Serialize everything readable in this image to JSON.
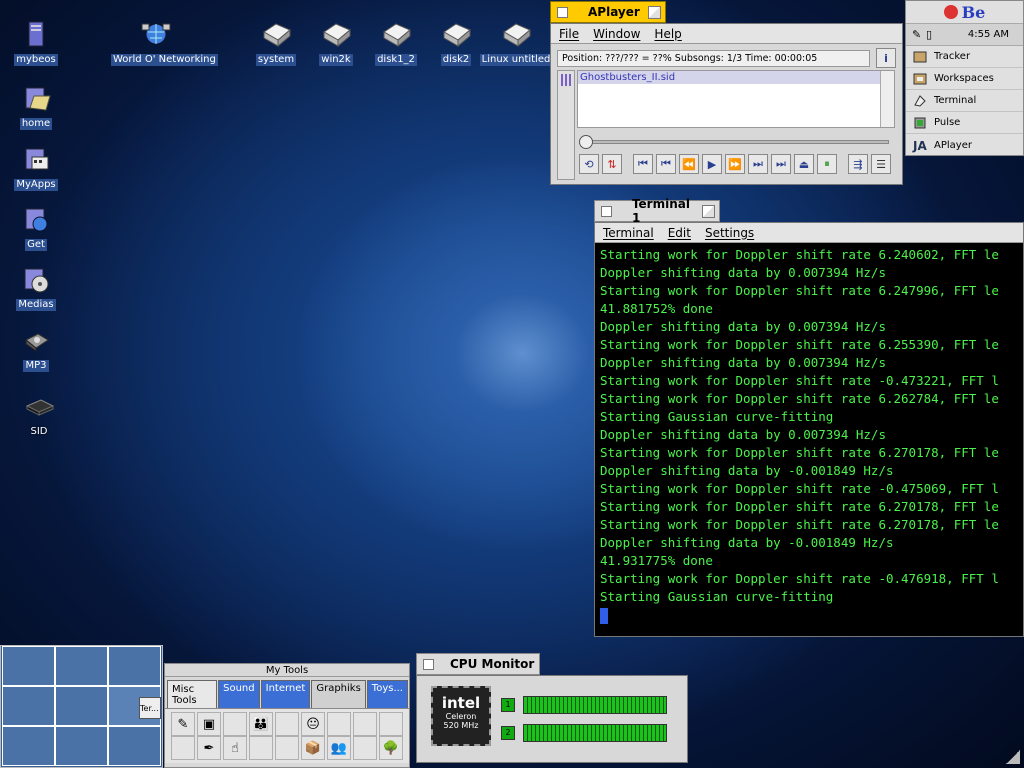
{
  "desktop_icons": [
    {
      "label": "mybeos",
      "icon": "computer-tower-icon",
      "selected": true
    },
    {
      "label": "World O' Networking",
      "icon": "network-globe-icon",
      "selected": true
    },
    {
      "label": "system",
      "icon": "disk-icon",
      "selected": true
    },
    {
      "label": "win2k",
      "icon": "disk-icon",
      "selected": true
    },
    {
      "label": "disk1_2",
      "icon": "disk-icon",
      "selected": true
    },
    {
      "label": "disk2",
      "icon": "disk-icon",
      "selected": true
    },
    {
      "label": "Linux untitled",
      "icon": "disk-icon",
      "selected": true
    },
    {
      "label": "home",
      "icon": "home-folder-icon",
      "selected": true
    },
    {
      "label": "MyApps",
      "icon": "apps-folder-icon",
      "selected": true
    },
    {
      "label": "Get",
      "icon": "get-folder-icon",
      "selected": true
    },
    {
      "label": "Medias",
      "icon": "media-folder-icon",
      "selected": true
    },
    {
      "label": "MP3",
      "icon": "mp3-drive-icon",
      "selected": true
    },
    {
      "label": "SID",
      "icon": "sid-chip-icon",
      "selected": false
    }
  ],
  "aplayer": {
    "title": "APlayer",
    "menus": [
      "File",
      "Window",
      "Help"
    ],
    "status": "Position: ???/??? = ??% Subsongs: 1/3 Time: 00:00:05",
    "playlist": [
      "Ghostbusters_II.sid"
    ]
  },
  "deskbar": {
    "logo": "Be",
    "time": "4:55 AM",
    "items": [
      {
        "label": "Tracker",
        "icon": "tracker-icon"
      },
      {
        "label": "Workspaces",
        "icon": "workspaces-icon"
      },
      {
        "label": "Terminal",
        "icon": "terminal-icon"
      },
      {
        "label": "Pulse",
        "icon": "pulse-icon"
      },
      {
        "label": "APlayer",
        "icon": "aplayer-icon"
      }
    ]
  },
  "terminal": {
    "title": "Terminal 1",
    "menus": [
      "Terminal",
      "Edit",
      "Settings"
    ],
    "lines": [
      "Starting work for Doppler shift rate 6.240602, FFT le",
      "Doppler shifting data by 0.007394 Hz/s",
      "Starting work for Doppler shift rate 6.247996, FFT le",
      "41.881752% done",
      "Doppler shifting data by 0.007394 Hz/s",
      "Starting work for Doppler shift rate 6.255390, FFT le",
      "Doppler shifting data by 0.007394 Hz/s",
      "Starting work for Doppler shift rate -0.473221, FFT l",
      "Starting work for Doppler shift rate 6.262784, FFT le",
      "Starting Gaussian curve-fitting",
      "Doppler shifting data by 0.007394 Hz/s",
      "Starting work for Doppler shift rate 6.270178, FFT le",
      "Doppler shifting data by -0.001849 Hz/s",
      "Starting work for Doppler shift rate -0.475069, FFT l",
      "Starting work for Doppler shift rate 6.270178, FFT le",
      "Starting work for Doppler shift rate 6.270178, FFT le",
      "Doppler shifting data by -0.001849 Hz/s",
      "41.931775% done",
      "Starting work for Doppler shift rate -0.476918, FFT l",
      "Starting Gaussian curve-fitting"
    ],
    "colors": {
      "bg": "#000000",
      "fg": "#4cf24c"
    }
  },
  "workspaces": {
    "mini_window_label": "Ter..."
  },
  "mytools": {
    "title": "My Tools",
    "tabs": [
      {
        "label": "Misc Tools",
        "color": "#e8e8e8"
      },
      {
        "label": "Sound",
        "color": "#3b6fd6"
      },
      {
        "label": "Internet",
        "color": "#3b6fd6"
      },
      {
        "label": "Graphiks",
        "color": "#d0d0d0"
      },
      {
        "label": "Toys...",
        "color": "#3b6fd6"
      }
    ]
  },
  "cpu_monitor": {
    "title": "CPU Monitor",
    "chip_brand": "intel",
    "chip_model": "Celeron",
    "chip_speed": "520 MHz",
    "cpus": [
      {
        "id": "1"
      },
      {
        "id": "2"
      }
    ]
  }
}
